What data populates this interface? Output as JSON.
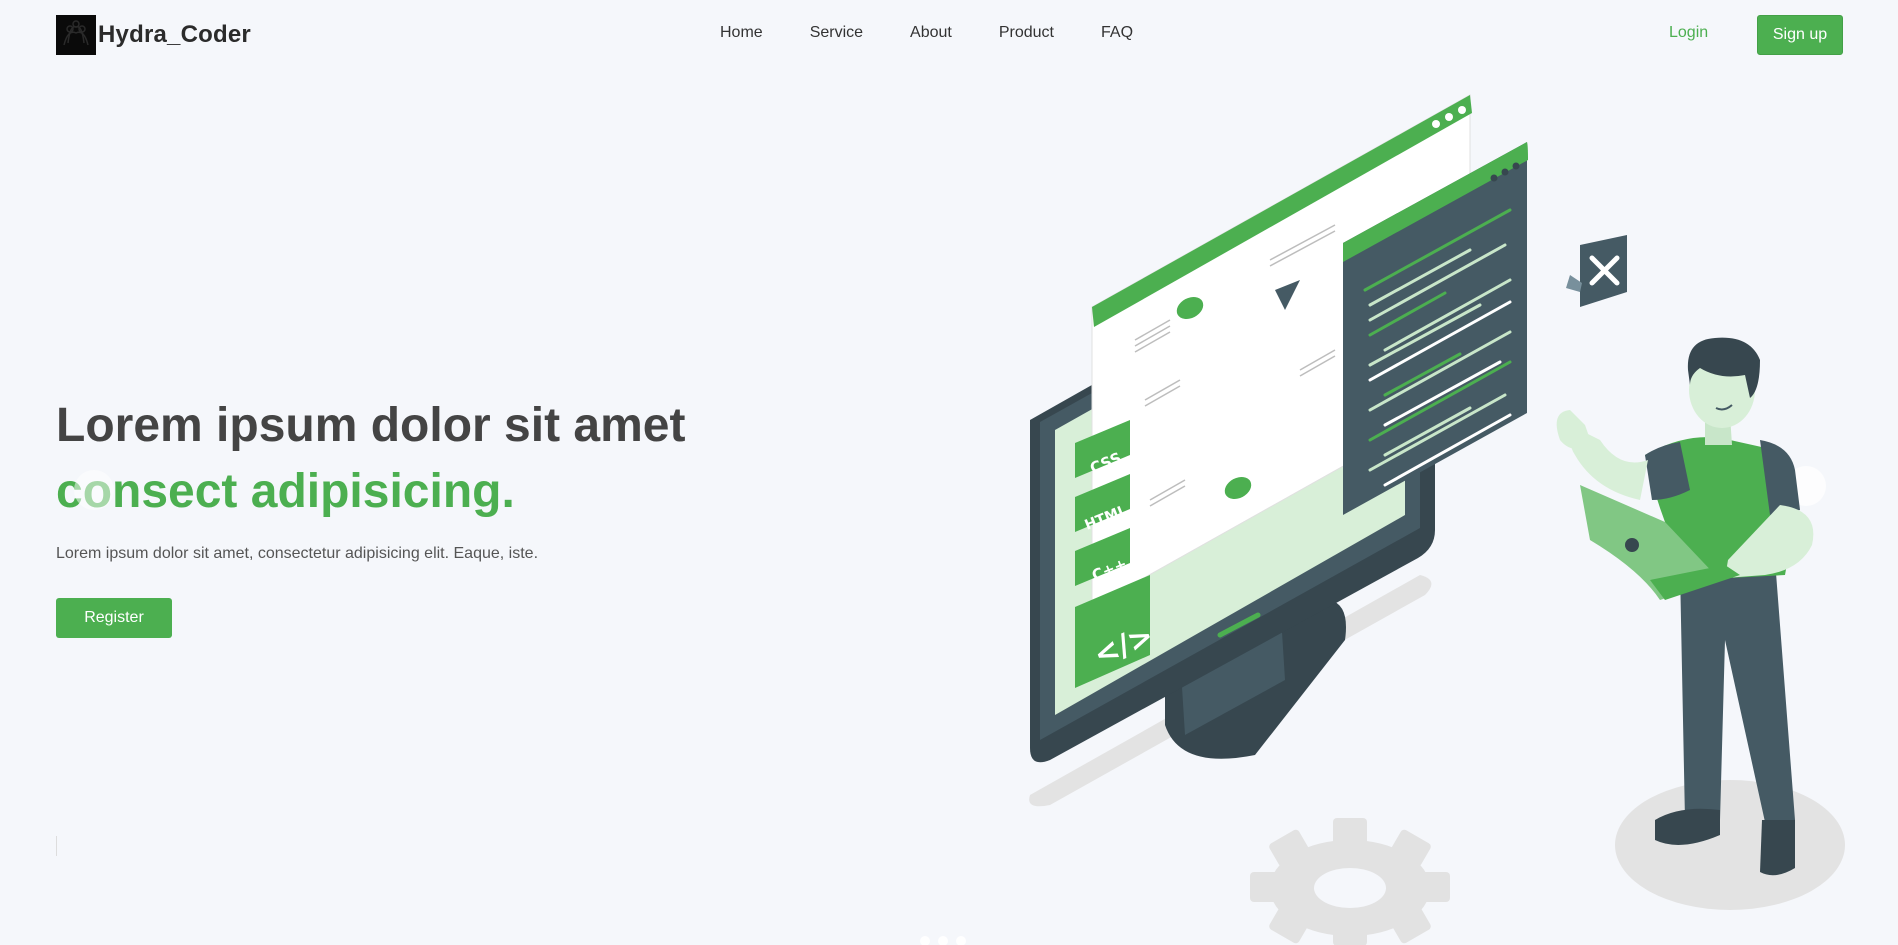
{
  "brand": {
    "name": "Hydra_Coder",
    "logo_icon": "hydra-logo-icon"
  },
  "nav": {
    "links": [
      "Home",
      "Service",
      "About",
      "Product",
      "FAQ"
    ],
    "login": "Login",
    "signup": "Sign up"
  },
  "hero": {
    "title_line1": "Lorem ipsum dolor sit amet",
    "title_line2": "consect adipisicing.",
    "description": "Lorem ipsum dolor sit amet, consectetur adipisicing elit. Eaque, iste.",
    "register": "Register"
  },
  "illustration": {
    "tags": [
      "CSS",
      "HTML",
      "C++",
      "</>"
    ]
  },
  "colors": {
    "accent": "#4caf50",
    "dark": "#455a64",
    "light_green": "#c8e6c9",
    "background": "#f5f7fb"
  }
}
